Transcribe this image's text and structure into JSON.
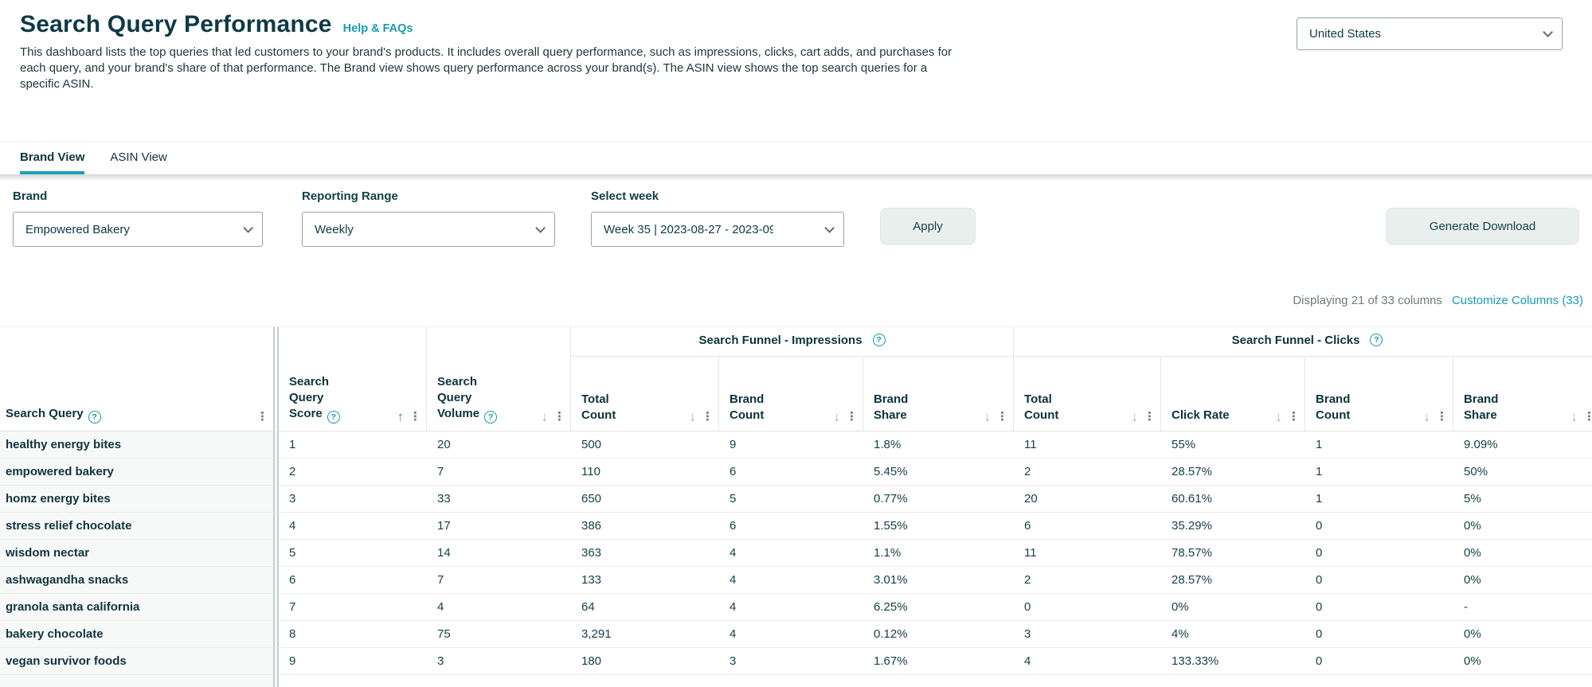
{
  "header": {
    "title": "Search Query Performance",
    "help_link": "Help & FAQs",
    "description": "This dashboard lists the top queries that led customers to your brand's products. It includes overall query performance, such as impressions, clicks, cart adds, and purchases for each query, and your brand's share of that performance. The Brand view shows query performance across your brand(s). The ASIN view shows the top search queries for a specific ASIN.",
    "marketplace": {
      "value": "United States"
    }
  },
  "tabs": [
    {
      "label": "Brand View",
      "active": true
    },
    {
      "label": "ASIN View",
      "active": false
    }
  ],
  "filters": {
    "brand": {
      "label": "Brand",
      "value": "Empowered Bakery"
    },
    "reporting_range": {
      "label": "Reporting Range",
      "value": "Weekly"
    },
    "select_week": {
      "label": "Select week",
      "value": "Week 35 | 2023-08-27 - 2023-09"
    },
    "apply_button": "Apply",
    "generate_download_button": "Generate Download"
  },
  "table_controls": {
    "displaying_text": "Displaying 21 of 33 columns",
    "customize_link": "Customize Columns (33)"
  },
  "table": {
    "column_groups": [
      {
        "label": "Search Funnel - Impressions",
        "has_info": true,
        "span": 3
      },
      {
        "label": "Search Funnel - Clicks",
        "has_info": true,
        "span": 4
      }
    ],
    "columns": [
      {
        "label": "Search Query",
        "has_info": true,
        "sort": "none"
      },
      {
        "label": "Search Query Score",
        "has_info": true,
        "sort": "asc"
      },
      {
        "label": "Search Query Volume",
        "has_info": true,
        "sort": "desc"
      },
      {
        "label": "Total Count",
        "has_info": false,
        "sort": "desc"
      },
      {
        "label": "Brand Count",
        "has_info": false,
        "sort": "desc"
      },
      {
        "label": "Brand Share",
        "has_info": false,
        "sort": "desc"
      },
      {
        "label": "Total Count",
        "has_info": false,
        "sort": "desc"
      },
      {
        "label": "Click Rate",
        "has_info": false,
        "sort": "desc"
      },
      {
        "label": "Brand Count",
        "has_info": false,
        "sort": "desc"
      },
      {
        "label": "Brand Share",
        "has_info": false,
        "sort": "desc"
      }
    ],
    "rows": [
      [
        "healthy energy bites",
        "1",
        "20",
        "500",
        "9",
        "1.8%",
        "11",
        "55%",
        "1",
        "9.09%"
      ],
      [
        "empowered bakery",
        "2",
        "7",
        "110",
        "6",
        "5.45%",
        "2",
        "28.57%",
        "1",
        "50%"
      ],
      [
        "homz energy bites",
        "3",
        "33",
        "650",
        "5",
        "0.77%",
        "20",
        "60.61%",
        "1",
        "5%"
      ],
      [
        "stress relief chocolate",
        "4",
        "17",
        "386",
        "6",
        "1.55%",
        "6",
        "35.29%",
        "0",
        "0%"
      ],
      [
        "wisdom nectar",
        "5",
        "14",
        "363",
        "4",
        "1.1%",
        "11",
        "78.57%",
        "0",
        "0%"
      ],
      [
        "ashwagandha snacks",
        "6",
        "7",
        "133",
        "4",
        "3.01%",
        "2",
        "28.57%",
        "0",
        "0%"
      ],
      [
        "granola santa california",
        "7",
        "4",
        "64",
        "4",
        "6.25%",
        "0",
        "0%",
        "0",
        "-"
      ],
      [
        "bakery chocolate",
        "8",
        "75",
        "3,291",
        "4",
        "0.12%",
        "3",
        "4%",
        "0",
        "0%"
      ],
      [
        "vegan survivor foods",
        "9",
        "3",
        "180",
        "3",
        "1.67%",
        "4",
        "133.33%",
        "0",
        "0%"
      ]
    ]
  },
  "colors": {
    "accent_teal": "#1795ab",
    "link_teal": "#199ab1",
    "tab_underline": "#1aa3b8",
    "dark_text": "#0e3a44",
    "button_bg": "#e9efec",
    "frozen_divider": "#c6cccc",
    "first_column_bg": "#f7f8f8"
  }
}
